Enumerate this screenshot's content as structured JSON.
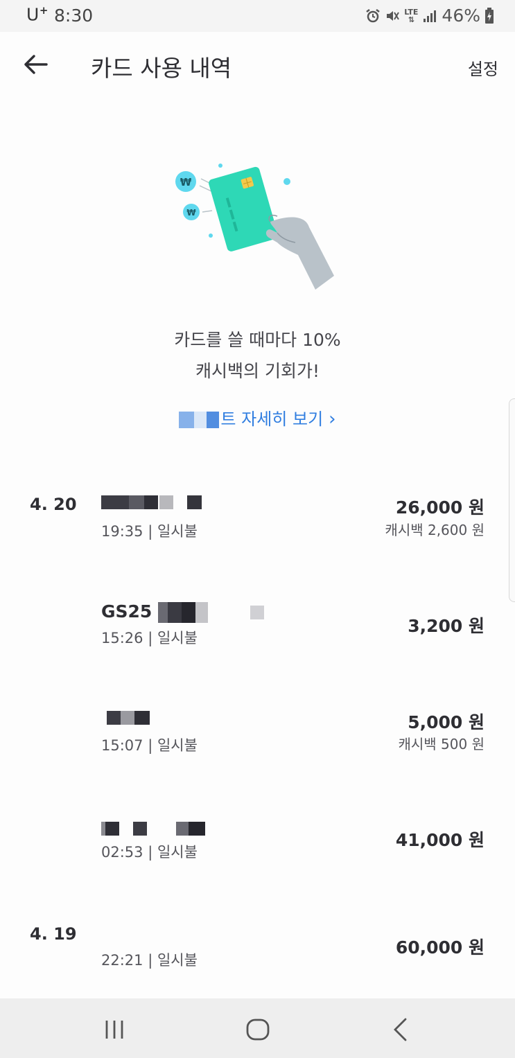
{
  "status_bar": {
    "carrier": "U",
    "carrier_plus": "+",
    "time": "8:30",
    "network": "LTE",
    "battery": "46%"
  },
  "header": {
    "title": "카드 사용 내역",
    "settings_label": "설정",
    "back_icon": "arrow-left-icon"
  },
  "promo": {
    "line1": "카드를 쓸 때마다 10%",
    "line2": "캐시백의 기회가!",
    "link_label": "트 자세히 보기",
    "link_chevron": "›",
    "accent_color": "#2f7de0",
    "card_color": "#2ed8b6"
  },
  "transactions": [
    {
      "date": "4. 20",
      "merchant": "",
      "time": "19:35 | 일시불",
      "amount": "26,000 원",
      "cashback": "캐시백 2,600 원"
    },
    {
      "date": "",
      "merchant": "GS25",
      "time": "15:26 | 일시불",
      "amount": "3,200 원",
      "cashback": ""
    },
    {
      "date": "",
      "merchant": "",
      "time": "15:07 | 일시불",
      "amount": "5,000 원",
      "cashback": "캐시백 500 원"
    },
    {
      "date": "",
      "merchant": "",
      "time": "02:53 | 일시불",
      "amount": "41,000 원",
      "cashback": ""
    },
    {
      "date": "4. 19",
      "merchant": "",
      "time": "22:21 | 일시불",
      "amount": "60,000 원",
      "cashback": ""
    }
  ],
  "navbar": {
    "recent_icon": "recent-apps-icon",
    "home_icon": "home-icon",
    "back_icon": "back-chevron-icon"
  }
}
